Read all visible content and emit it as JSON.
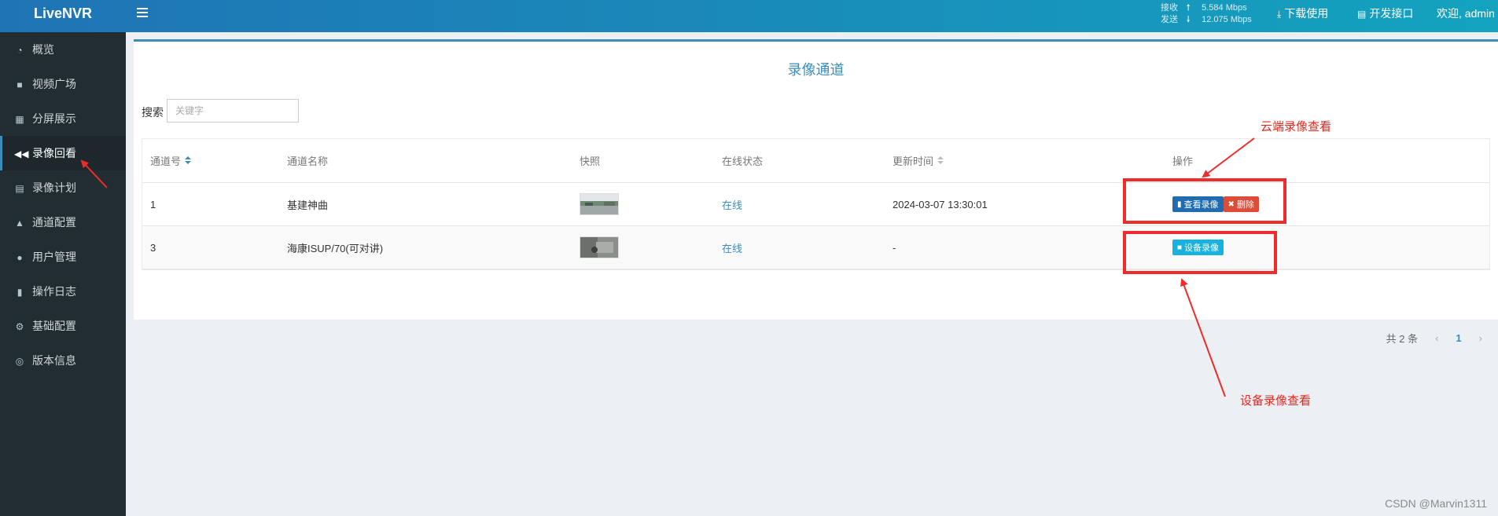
{
  "header": {
    "brand": "LiveNVR",
    "speed": {
      "rx_label": "接收",
      "rx_arrow": "🠕",
      "rx_value": "5.584 Mbps",
      "tx_label": "发送",
      "tx_arrow": "🠗",
      "tx_value": "12.075 Mbps"
    },
    "download_label": "下载使用",
    "api_label": "开发接口",
    "welcome": "欢迎, admin"
  },
  "sidebar": {
    "items": [
      {
        "label": "概览",
        "icon": "dashboard-icon"
      },
      {
        "label": "视频广场",
        "icon": "video-camera-icon"
      },
      {
        "label": "分屏展示",
        "icon": "grid-icon"
      },
      {
        "label": "录像回看",
        "icon": "rewind-icon",
        "active": true
      },
      {
        "label": "录像计划",
        "icon": "calendar-icon"
      },
      {
        "label": "通道配置",
        "icon": "road-icon"
      },
      {
        "label": "用户管理",
        "icon": "users-icon"
      },
      {
        "label": "操作日志",
        "icon": "file-icon"
      },
      {
        "label": "基础配置",
        "icon": "gears-icon"
      },
      {
        "label": "版本信息",
        "icon": "lifebuoy-icon"
      }
    ]
  },
  "main": {
    "title": "录像通道",
    "search": {
      "label": "搜索",
      "placeholder": "关键字",
      "value": ""
    },
    "table": {
      "columns": [
        "通道号",
        "通道名称",
        "快照",
        "在线状态",
        "更新时间",
        "操作"
      ],
      "rows": [
        {
          "id": "1",
          "name": "基建神曲",
          "status": "在线",
          "updated": "2024-03-07 13:30:01",
          "actions": [
            "查看录像",
            "删除"
          ]
        },
        {
          "id": "3",
          "name": "海康ISUP/70(可对讲)",
          "status": "在线",
          "updated": "-",
          "actions": [
            "设备录像"
          ]
        }
      ]
    },
    "pagination": {
      "total": "共 2 条",
      "current": "1"
    }
  },
  "annotations": {
    "cloud": "云端录像查看",
    "device": "设备录像查看"
  },
  "watermark": "CSDN @Marvin1311",
  "colors": {
    "accent": "#3c8dbc",
    "sidebar": "#222d32",
    "annotation": "#ef2b2b"
  }
}
